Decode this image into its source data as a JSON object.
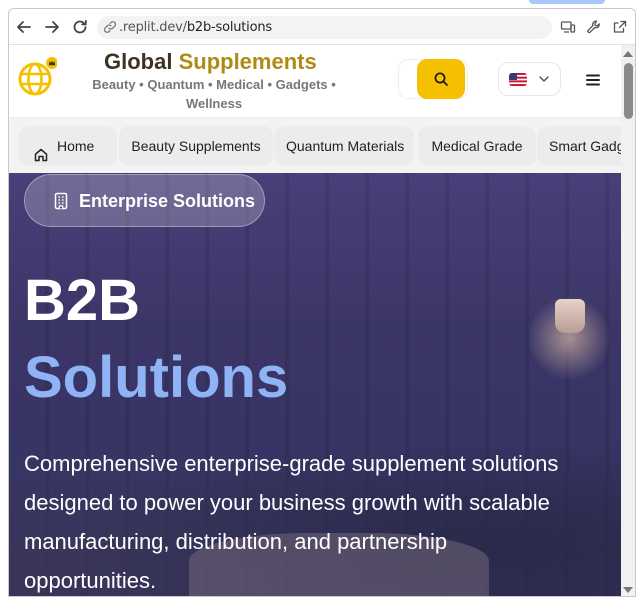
{
  "browser": {
    "url_host": ".replit.dev/",
    "url_path": "b2b-solutions"
  },
  "header": {
    "brand_word1": "Global",
    "brand_word2": "Supplements",
    "tagline": "Beauty • Quantum • Medical • Gadgets • Wellness",
    "accent_color": "#f5c000",
    "brand_gold": "#b08a16"
  },
  "nav": {
    "items": [
      {
        "label": "Home"
      },
      {
        "label": "Beauty Supplements"
      },
      {
        "label": "Quantum Materials"
      },
      {
        "label": "Medical Grade"
      },
      {
        "label": "Smart Gadg"
      }
    ]
  },
  "hero": {
    "badge": "Enterprise Solutions",
    "title_line1": "B2B",
    "title_line2": "Solutions",
    "title_accent": "#8fb3f5",
    "description": "Comprehensive enterprise-grade supplement solutions designed to power your business growth with scalable manufacturing, distribution, and partnership opportunities."
  }
}
